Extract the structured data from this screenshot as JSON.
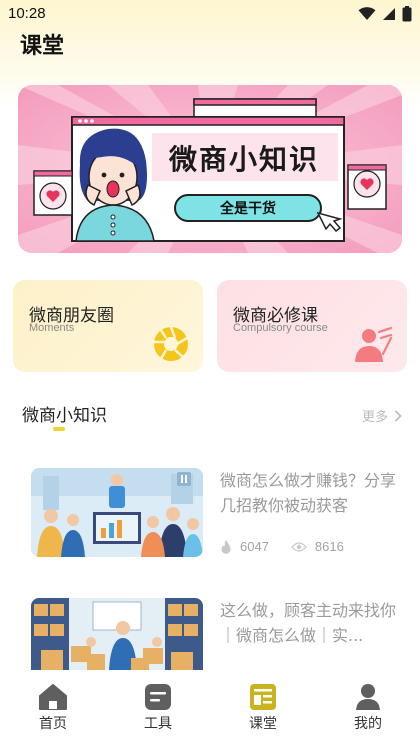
{
  "status_bar": {
    "time": "10:28"
  },
  "page": {
    "title": "课堂"
  },
  "banner": {
    "headline": "微商小知识",
    "button_label": "全是干货"
  },
  "categories": [
    {
      "title": "微商朋友圈",
      "subtitle": "Moments",
      "icon": "aperture-icon",
      "color": "#f5c51c"
    },
    {
      "title": "微商必修课",
      "subtitle": "Compulsory course",
      "icon": "person-icon",
      "color": "#f47c80"
    }
  ],
  "section": {
    "title": "微商小知识",
    "more_label": "更多"
  },
  "articles": [
    {
      "title": "微商怎么做才赚钱？分享几招教你被动获客",
      "likes": "6047",
      "views": "8616"
    },
    {
      "title": "这么做，顾客主动来找你｜微商怎么做｜实..."
    }
  ],
  "tabbar": {
    "active": "课堂",
    "items": [
      {
        "label": "首页",
        "icon": "home-icon"
      },
      {
        "label": "工具",
        "icon": "tools-icon"
      },
      {
        "label": "课堂",
        "icon": "classroom-icon"
      },
      {
        "label": "我的",
        "icon": "profile-icon"
      }
    ]
  },
  "colors": {
    "accent": "#f5d22e",
    "banner_pink": "#f7a9c6",
    "active_tab": "#c9b31f"
  }
}
